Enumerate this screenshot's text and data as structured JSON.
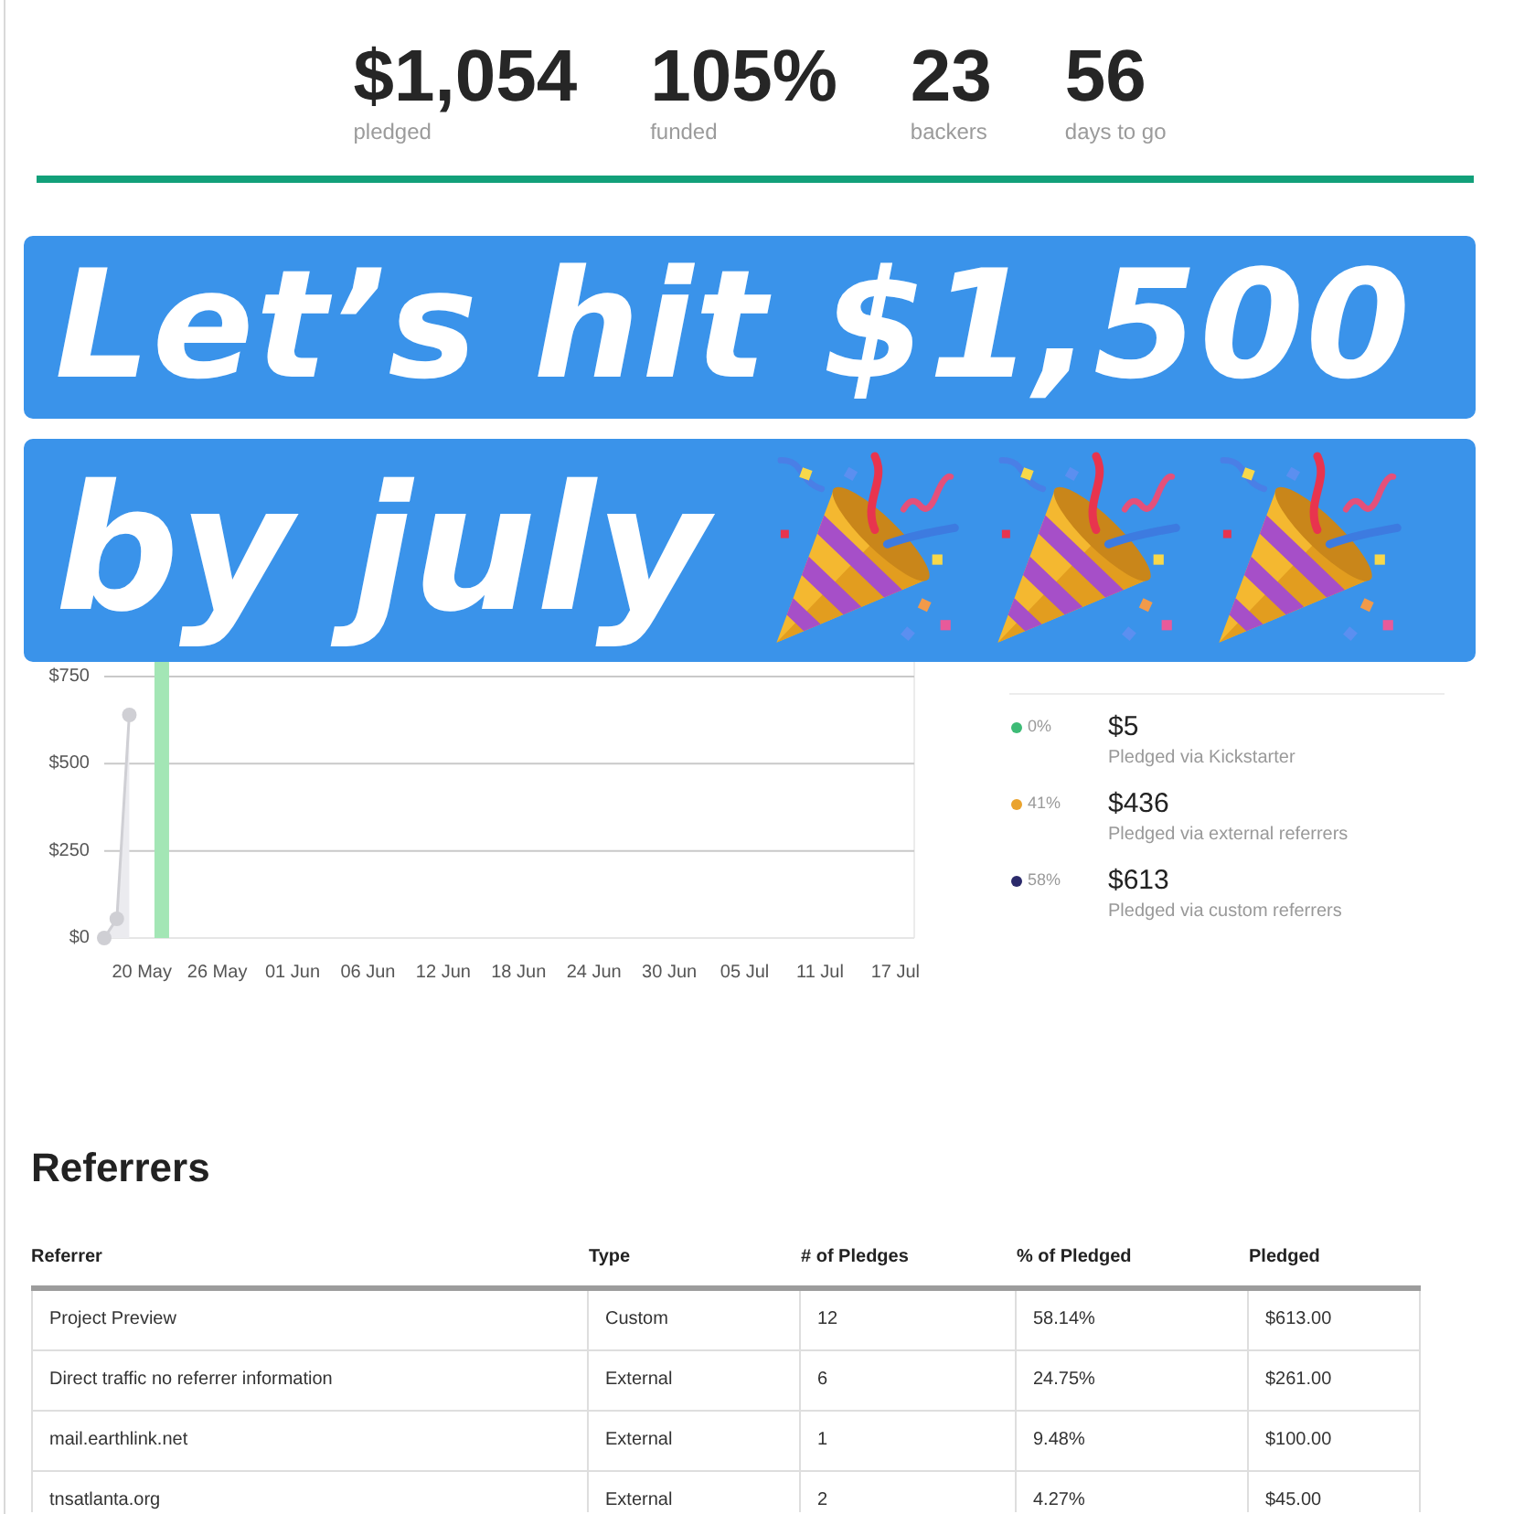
{
  "stats": [
    {
      "value": "$1,054",
      "label": "pledged"
    },
    {
      "value": "105%",
      "label": "funded"
    },
    {
      "value": "23",
      "label": "backers"
    },
    {
      "value": "56",
      "label": "days to go"
    }
  ],
  "progress": {
    "level": 1
  },
  "banner": {
    "lines": [
      "Let’s hit $1,500",
      "by july"
    ]
  },
  "funding_chart": {
    "chart_data": {
      "type": "area",
      "grid": true,
      "categories": [
        null,
        null,
        null,
        "20 May",
        null,
        null,
        null,
        null,
        null,
        "26 May",
        null,
        null,
        null,
        null,
        null,
        "01 Jun",
        null,
        null,
        null,
        null,
        null,
        "06 Jun",
        null,
        null,
        null,
        null,
        null,
        "12 Jun",
        null,
        null,
        null,
        null,
        null,
        "18 Jun",
        null,
        null,
        null,
        null,
        null,
        "24 Jun",
        null,
        null,
        null,
        null,
        null,
        "30 Jun",
        null,
        null,
        null,
        null,
        null,
        "05 Jul",
        null,
        null,
        null,
        null,
        null,
        "11 Jul",
        null,
        null,
        null,
        null,
        null,
        "17 Jul",
        null
      ],
      "series": [
        {
          "color": "#cfcfd4",
          "values": [
            0,
            55,
            640,
            null,
            null,
            null,
            null,
            null,
            null,
            null,
            null,
            null,
            null,
            null,
            null,
            null,
            null,
            null,
            null,
            null,
            null,
            null,
            null,
            null,
            null,
            null,
            null,
            null,
            null,
            null,
            null,
            null,
            null,
            null,
            null,
            null,
            null,
            null,
            null,
            null,
            null,
            null,
            null,
            null,
            null,
            null,
            null,
            null,
            null,
            null,
            null,
            null,
            null,
            null,
            null,
            null,
            null,
            null,
            null,
            null,
            null,
            null,
            null,
            null,
            null
          ]
        }
      ],
      "ylim": [
        0,
        780
      ],
      "yticks": [
        {
          "value": 0,
          "label": "$0"
        },
        {
          "value": 250,
          "label": "$250"
        },
        {
          "value": 500,
          "label": "$500"
        },
        {
          "value": 750,
          "label": "$750"
        }
      ]
    }
  },
  "sources": [
    {
      "percent": "0%",
      "amount": "$5",
      "caption": "Pledged via Kickstarter",
      "color": "#3dbb76"
    },
    {
      "percent": "41%",
      "amount": "$436",
      "caption": "Pledged via external referrers",
      "color": "#eaa32e"
    },
    {
      "percent": "58%",
      "amount": "$613",
      "caption": "Pledged via custom referrers",
      "color": "#2b2a6b"
    }
  ],
  "referrers": {
    "title": "Referrers",
    "columns": [
      "Referrer",
      "Type",
      "# of Pledges",
      "% of Pledged",
      "Pledged"
    ],
    "rows": [
      [
        "Project Preview",
        "Custom",
        "12",
        "58.14%",
        "$613.00"
      ],
      [
        "Direct traffic no referrer information",
        "External",
        "6",
        "24.75%",
        "$261.00"
      ],
      [
        "mail.earthlink.net",
        "External",
        "1",
        "9.48%",
        "$100.00"
      ],
      [
        "tnsatlanta.org",
        "External",
        "2",
        "4.27%",
        "$45.00"
      ]
    ]
  }
}
